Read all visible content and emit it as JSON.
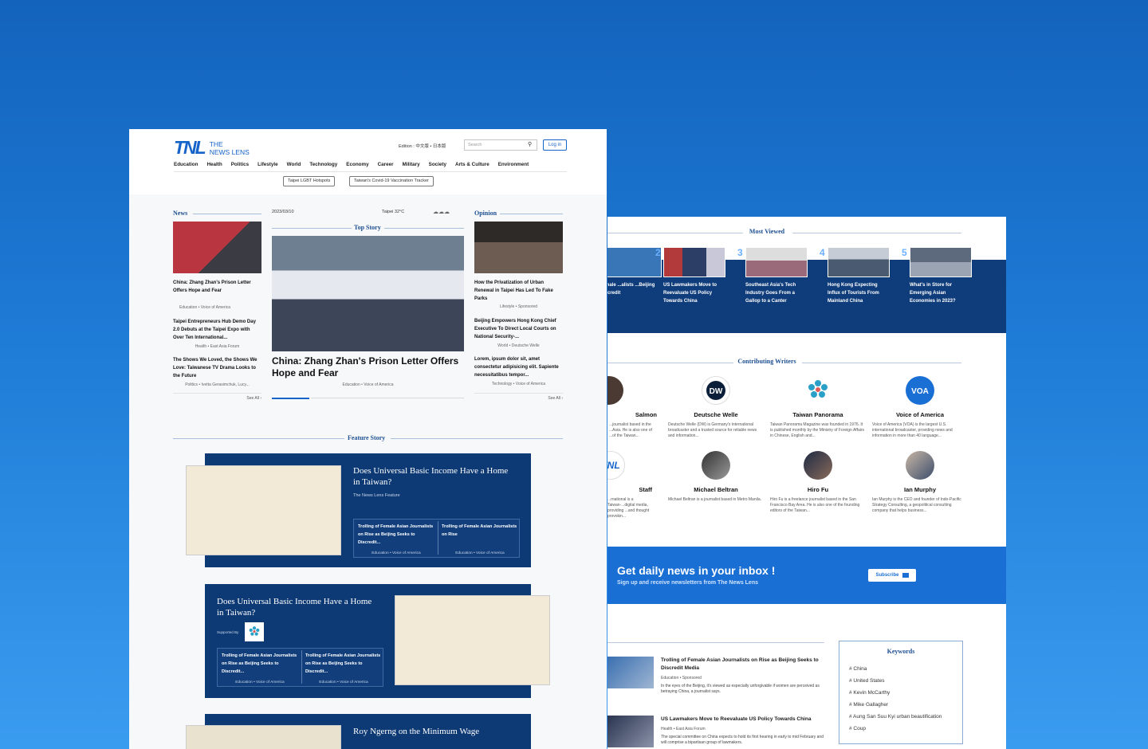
{
  "front": {
    "logo": {
      "mark": "TNL",
      "line1": "THE",
      "line2": "NEWS LENS"
    },
    "edition": "Edition : 中文版 • 日本版",
    "search_placeholder": "Search",
    "login": "Log in",
    "nav": [
      "Education",
      "Health",
      "Politics",
      "Lifestyle",
      "World",
      "Technology",
      "Economy",
      "Career",
      "Military",
      "Society",
      "Arts & Culture",
      "Environment"
    ],
    "tags": [
      "Taipei LGBT Hotspots",
      "Taiwan's Covid-19 Vaccination Tracker"
    ],
    "news": {
      "title": "News",
      "items": [
        {
          "headline": "China: Zhang Zhan's Prison Letter Offers Hope and Fear",
          "meta": "Education  •  Voice of America"
        },
        {
          "headline": "Taipei Entrepreneurs Hub Demo Day 2.0 Debuts at the Taipei Expo with Over Ten International...",
          "meta": "Health  •  East Asia Forum"
        },
        {
          "headline": "The Shows We Loved, the Shows We Love: Taiwanese TV Drama Looks to the Future",
          "meta": "Politics  •  Ivetta Gerasimchuk, Lucy..."
        }
      ],
      "see_all": "See All  ›"
    },
    "top_story": {
      "date": "2023/03/10",
      "weather": "Taipei  32°C",
      "title": "Top Story",
      "headline": "China: Zhang Zhan's Prison Letter Offers Hope and Fear",
      "meta": "Education  •  Voice of America"
    },
    "opinion": {
      "title": "Opinion",
      "items": [
        {
          "headline": "How the Privatization of Urban Renewal in Taipei Has Led To Fake Parks",
          "meta": "Lifestyle  •  Sponsored"
        },
        {
          "headline": "Beijing Empowers Hong Kong Chief Executive To Direct Local Courts on National Security-...",
          "meta": "World  •  Deutsche Welle"
        },
        {
          "headline": "Lorem, ipsum dolor sit, amet consectetur adipisicing elit. Sapiente necessitatibus tempor...",
          "meta": "Technology  •  Voice of America"
        }
      ],
      "see_all": "See All  ›"
    },
    "feature": {
      "title": "Feature Story",
      "card1": {
        "headline": "Does Universal Basic Income Have a Home in Taiwan?",
        "source": "The News Lens Feature",
        "subs": [
          {
            "headline": "Trolling of Female Asian Journalists on Rise as Beijing Seeks to Discredit...",
            "meta": "Education  •  Voice of America"
          },
          {
            "headline": "Trolling of Female Asian Journalists on Rise",
            "meta": "Education  •  Voice of America"
          }
        ]
      },
      "card2": {
        "headline": "Does Universal Basic Income Have a Home in Taiwan?",
        "supported": "Supported By",
        "subs": [
          {
            "headline": "Trolling of Female Asian Journalists on Rise as Beijing Seeks to Discredit...",
            "meta": "Education  •  Voice of America"
          },
          {
            "headline": "Trolling of Female Asian Journalists on Rise as Beijing Seeks to Discredit...",
            "meta": "Education  •  Voice of America"
          }
        ]
      },
      "card3": {
        "headline": "Roy Ngerng on the Minimum Wage"
      }
    }
  },
  "back": {
    "most_viewed": {
      "title": "Most Viewed",
      "items": [
        {
          "num": "",
          "headline": "Female ...alists ...Beijing ...iscredit"
        },
        {
          "num": "2",
          "headline": "US Lawmakers Move to Reevaluate US Policy Towards China"
        },
        {
          "num": "3",
          "headline": "Southeast Asia's Tech Industry Goes From a Gallop to a Canter"
        },
        {
          "num": "4",
          "headline": "Hong Kong Expecting Influx of Tourists From Mainland China"
        },
        {
          "num": "5",
          "headline": "What's in Store for Emerging Asian Economies in 2023?"
        }
      ]
    },
    "writers": {
      "title": "Contributing Writers",
      "row1": [
        {
          "name": "Salmon",
          "desc": "...journalist based in the ...Asia. He is also one of ...of the Taiwan..."
        },
        {
          "name": "Deutsche Welle",
          "desc": "Deutsche Welle (DW) is Germany's international broadcaster and a trusted source for reliable news and information..."
        },
        {
          "name": "Taiwan Panorama",
          "desc": "Taiwan Panorama Magazine was founded in 1976. It is published monthly by the Ministry of Foreign Affairs in Chinese, English and..."
        },
        {
          "name": "Voice of America",
          "desc": "Voice of America (VOA) is the largest U.S. international broadcaster, providing news and information in more than 40 language..."
        }
      ],
      "row2": [
        {
          "name": "Staff",
          "desc": "...rnational is a Taiwan-...digital media, providing ...and thought provokin..."
        },
        {
          "name": "Michael Beltran",
          "desc": "Michael Beltran is a journalist based in Metro Manila."
        },
        {
          "name": "Hiro Fu",
          "desc": "Hiro Fu is a freelance journalist based in the San Francisco Bay Area. He is also one of the founding editors of the Taiwan..."
        },
        {
          "name": "Ian Murphy",
          "desc": "Ian Murphy is the CEO and founder of Indo-Pacific Strategy Consulting, a geopolitical consulting company that helps business..."
        }
      ]
    },
    "newsletter": {
      "heading": "Get daily news in your inbox !",
      "sub": "Sign up and receive newsletters from The News Lens",
      "button": "Subscribe"
    },
    "articles": [
      {
        "headline": "Trolling of Female Asian Journalists on Rise as Beijing Seeks to Discredit Media",
        "meta": "Education  •  Sponsored",
        "desc": "In the eyes of the Beijing, it's viewed as especially unforgivable if women are perceived as betraying China, a journalist says."
      },
      {
        "headline": "US Lawmakers Move to Reevaluate US Policy Towards China",
        "meta": "Health  •  East Asia Forum",
        "desc": "The special committee on China expects to hold its first hearing in early to mid February and will comprise a bipartisan group of lawmakers."
      }
    ],
    "keywords": {
      "title": "Keywords",
      "items": [
        "# China",
        "# United States",
        "# Kevin McCarthy",
        "# Mike Gallagher",
        "# Aung San Suu Kyi urban beautification",
        "# Coup"
      ]
    }
  }
}
